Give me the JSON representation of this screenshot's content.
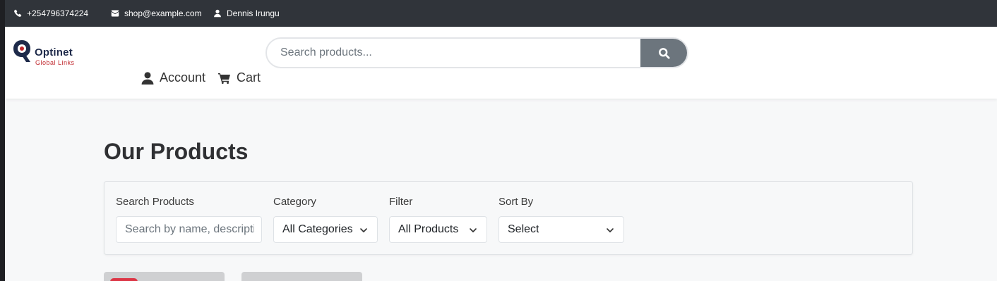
{
  "topbar": {
    "phone": "+254796374224",
    "email": "shop@example.com",
    "user": "Dennis Irungu"
  },
  "header": {
    "logo_name": "Optinet",
    "logo_tagline": "Global Links",
    "search_placeholder": "Search products...",
    "nav": {
      "account": "Account",
      "cart": "Cart"
    }
  },
  "main": {
    "title": "Our Products",
    "filters": {
      "search_label": "Search Products",
      "search_placeholder": "Search by name, description...",
      "category_label": "Category",
      "category_value": "All Categories",
      "filter_label": "Filter",
      "filter_value": "All Products",
      "sort_label": "Sort By",
      "sort_value": "Select"
    }
  },
  "colors": {
    "topbar_bg": "#30343a",
    "search_button": "#6c757d",
    "brand_red": "#c0272d",
    "brand_navy": "#1e2a4a",
    "badge_red": "#dc3545"
  },
  "icons": [
    "phone-icon",
    "mail-icon",
    "user-icon",
    "search-icon",
    "account-icon",
    "cart-icon",
    "chevron-down-icon"
  ]
}
